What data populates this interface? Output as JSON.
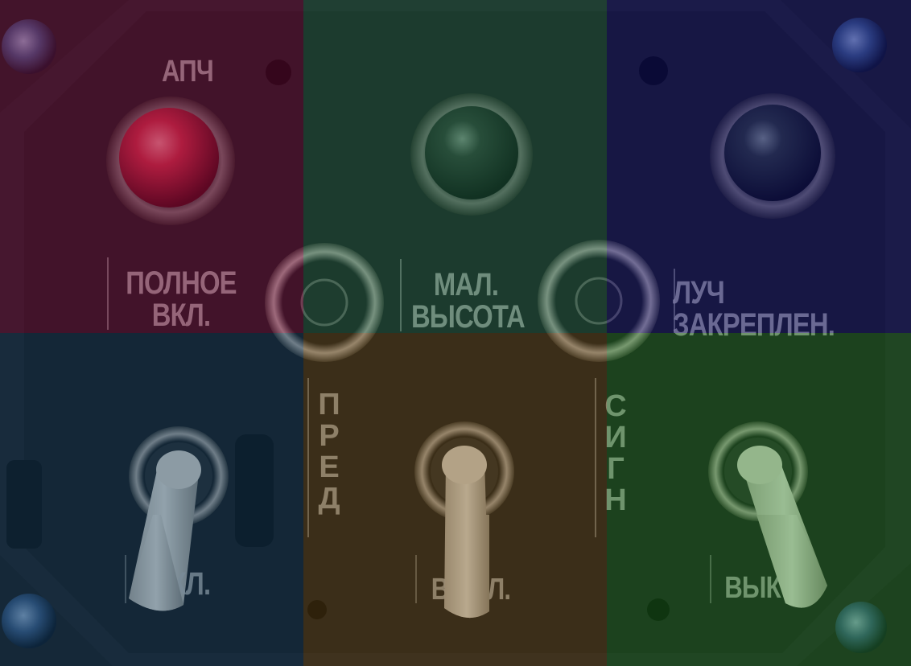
{
  "labels": {
    "apch": "АПЧ",
    "full_on_1": "ПОЛНОЕ",
    "full_on_2": "ВКЛ.",
    "low_alt_1": "МАЛ.",
    "low_alt_2": "ВЫСОТА",
    "beam_1": "ЛУЧ",
    "beam_2": "ЗАКРЕПЛЕН.",
    "pred": [
      "П",
      "Р",
      "Е",
      "Д"
    ],
    "sign": [
      "С",
      "И",
      "Г",
      "Н"
    ],
    "toggle1": "ВКЛ.",
    "toggle2": "ВЫКЛ.",
    "toggle3": "ВЫК"
  },
  "lamps": [
    {
      "name": "apch-lamp",
      "color": "#c8283c"
    },
    {
      "name": "low-altitude-lamp",
      "color": "#2a2e2a"
    },
    {
      "name": "beam-locked-lamp",
      "color": "#2a2e2a"
    }
  ],
  "quadrant_tints": [
    "#7a0a3c",
    "#1e6a46",
    "#14147a",
    "#0c3a5a",
    "#6a4a14",
    "#1e7a1e"
  ]
}
